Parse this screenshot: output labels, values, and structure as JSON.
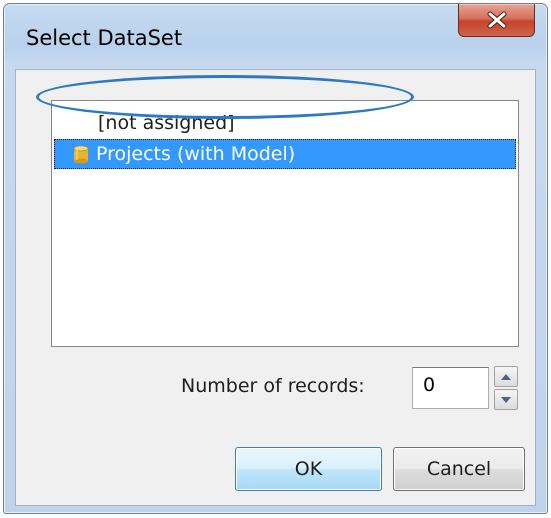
{
  "window": {
    "title": "Select DataSet",
    "close_icon": "close-x-icon"
  },
  "list": {
    "items": [
      {
        "label": "[not assigned]",
        "selected": false,
        "icon": ""
      },
      {
        "label": "Projects (with Model)",
        "selected": true,
        "icon": "database-cylinder-icon"
      }
    ]
  },
  "records": {
    "label": "Number of records:",
    "value": "0"
  },
  "buttons": {
    "ok_label": "OK",
    "cancel_label": "Cancel"
  },
  "colors": {
    "selection": "#3399ff",
    "highlight_ring": "#2e79c3",
    "close_button": "#c4432a"
  }
}
